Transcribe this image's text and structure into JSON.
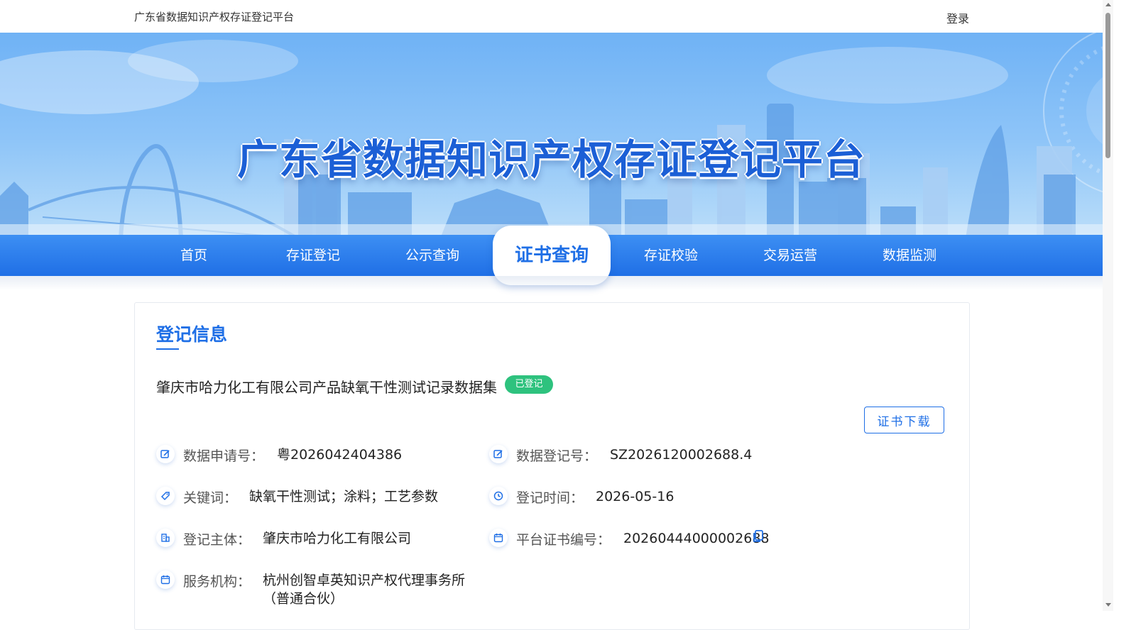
{
  "topbar": {
    "site_name": "广东省数据知识产权存证登记平台",
    "login_label": "登录"
  },
  "banner": {
    "title": "广东省数据知识产权存证登记平台"
  },
  "nav": {
    "items": [
      {
        "label": "首页",
        "active": false
      },
      {
        "label": "存证登记",
        "active": false
      },
      {
        "label": "公示查询",
        "active": false
      },
      {
        "label": "证书查询",
        "active": true
      },
      {
        "label": "存证校验",
        "active": false
      },
      {
        "label": "交易运营",
        "active": false
      },
      {
        "label": "数据监测",
        "active": false
      }
    ]
  },
  "card": {
    "title": "登记信息",
    "dataset_name": "肇庆市哈力化工有限公司产品缺氧干性测试记录数据集",
    "status": "已登记",
    "download_label": "证书下载",
    "fields": {
      "apply_no": {
        "label": "数据申请号：",
        "value": "粤2026042404386"
      },
      "reg_no": {
        "label": "数据登记号：",
        "value": "SZ2026120002688.4"
      },
      "keywords": {
        "label": "关键词：",
        "value": "缺氧干性测试；涂料；工艺参数"
      },
      "reg_time": {
        "label": "登记时间：",
        "value": "2026-05-16"
      },
      "subject": {
        "label": "登记主体：",
        "value": "肇庆市哈力化工有限公司"
      },
      "cert_no": {
        "label": "平台证书编号：",
        "value": "20260444000002688"
      },
      "agency": {
        "label": "服务机构：",
        "value": "杭州创智卓英知识产权代理事务所",
        "value_line2": "（普通合伙）"
      }
    }
  },
  "colors": {
    "primary": "#1f6fe6",
    "success": "#2ec27e"
  }
}
